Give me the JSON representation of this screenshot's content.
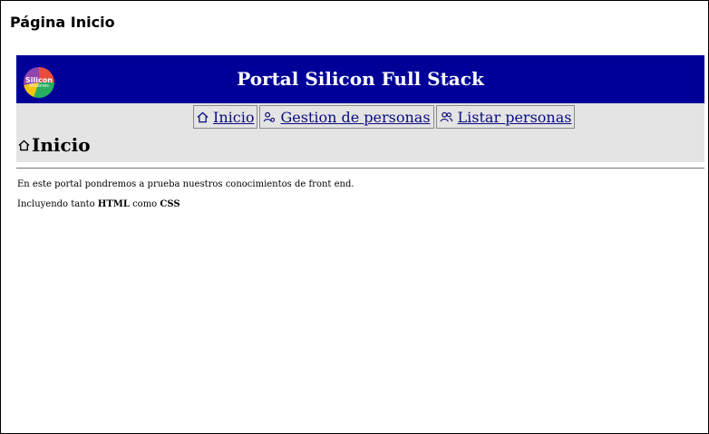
{
  "window": {
    "title": "Página Inicio"
  },
  "header": {
    "logo_line1": "Silicon",
    "logo_line2": "Misiones",
    "title": "Portal Silicon Full Stack",
    "background": "#000098"
  },
  "nav": {
    "items": [
      {
        "label": " Inicio ",
        "icon": "home-icon"
      },
      {
        "label": " Gestion de personas ",
        "icon": "people-manage-icon"
      },
      {
        "label": " Listar personas",
        "icon": "people-list-icon"
      }
    ]
  },
  "main": {
    "heading": "Inicio",
    "paragraph1": "En este portal pondremos a prueba nuestros conocimientos de front end.",
    "paragraph2": {
      "prefix": "Incluyendo tanto ",
      "strong1": "HTML",
      "middle": " como ",
      "strong2": "CSS"
    }
  }
}
